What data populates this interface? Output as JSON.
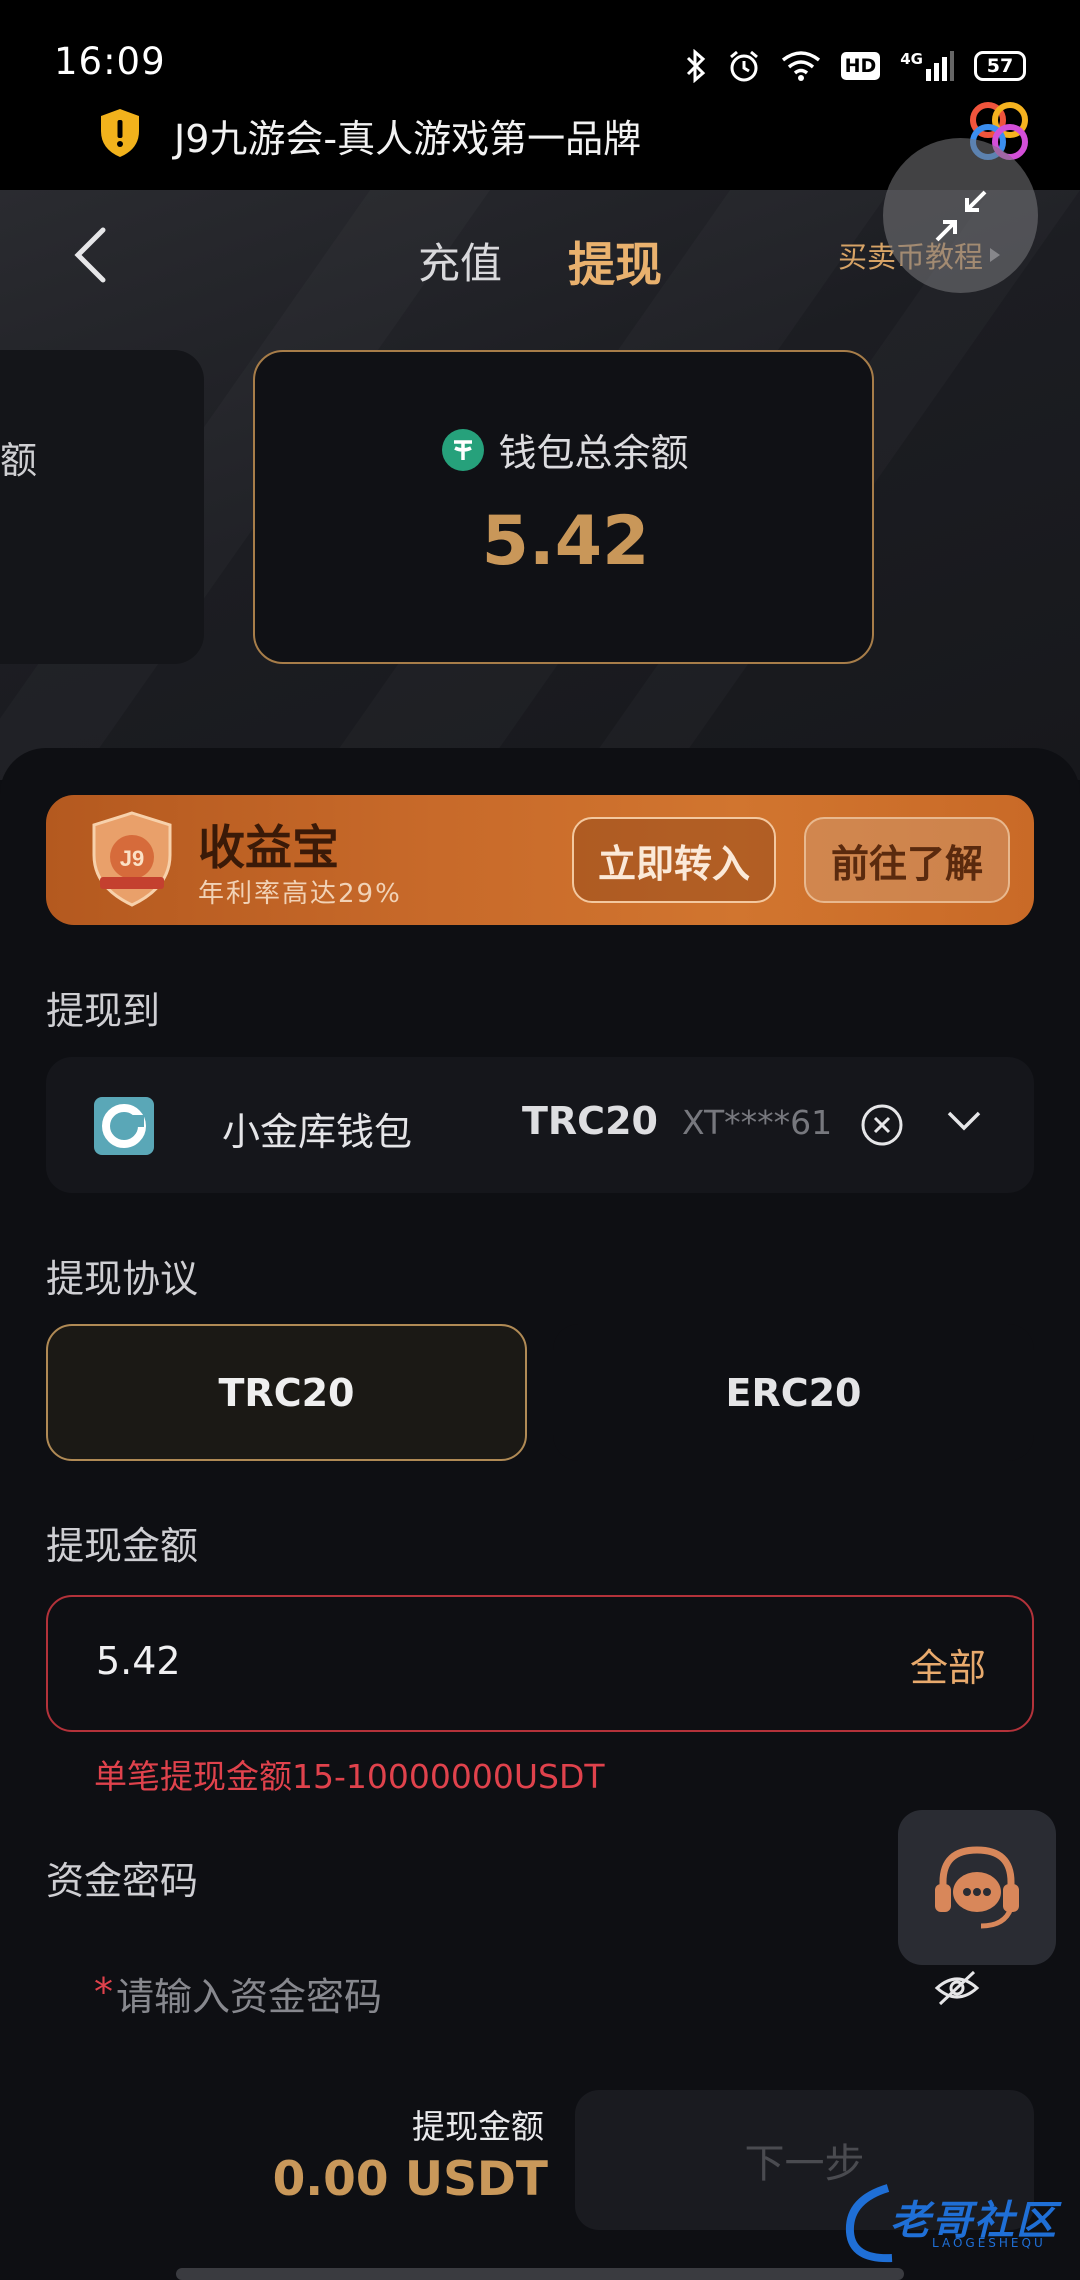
{
  "status_bar": {
    "time": "16:09",
    "hd": "HD",
    "network": "4G",
    "battery": "57"
  },
  "app_bar": {
    "title": "J9九游会-真人游戏第一品牌"
  },
  "header": {
    "tabs": [
      {
        "label": "充值",
        "active": false
      },
      {
        "label": "提现",
        "active": true
      }
    ],
    "tutorial_link": "买卖币教程",
    "left_card_text": "额",
    "balance_label": "钱包总余额",
    "balance_value": "5.42"
  },
  "yield_banner": {
    "title": "收益宝",
    "subtitle": "年利率高达29%",
    "badge_text": "J9",
    "transfer_label": "立即转入",
    "learn_label": "前往了解"
  },
  "withdraw_to": {
    "label": "提现到",
    "wallet_name": "小金库钱包",
    "protocol": "TRC20",
    "address": "XT****61"
  },
  "protocol": {
    "label": "提现协议",
    "options": [
      {
        "label": "TRC20",
        "selected": true
      },
      {
        "label": "ERC20",
        "selected": false
      }
    ]
  },
  "amount": {
    "label": "提现金额",
    "value": "5.42",
    "all_label": "全部",
    "error": "单笔提现金额15-10000000USDT"
  },
  "password": {
    "label": "资金密码",
    "required_mark": "*",
    "placeholder": "请输入资金密码"
  },
  "footer": {
    "amount_label": "提现金额",
    "amount_value": "0.00 USDT",
    "next_label": "下一步"
  },
  "watermark": {
    "text": "老哥社区",
    "sub": "LAOGESHEQU"
  },
  "colors": {
    "accent_gold": "#e9b16e",
    "balance_gold": "#c99759",
    "error_red": "#e0424c",
    "usdt_green": "#26a17b",
    "banner_orange": "#c86a2a"
  },
  "icons": [
    "shield-icon",
    "app-logo-icon",
    "back-arrow-icon",
    "collapse-icon",
    "usdt-icon",
    "yield-badge-icon",
    "wallet-logo-icon",
    "clear-icon",
    "chevron-down-icon",
    "eye-off-icon",
    "customer-service-icon",
    "bluetooth-icon",
    "alarm-icon",
    "wifi-icon",
    "signal-icon"
  ]
}
